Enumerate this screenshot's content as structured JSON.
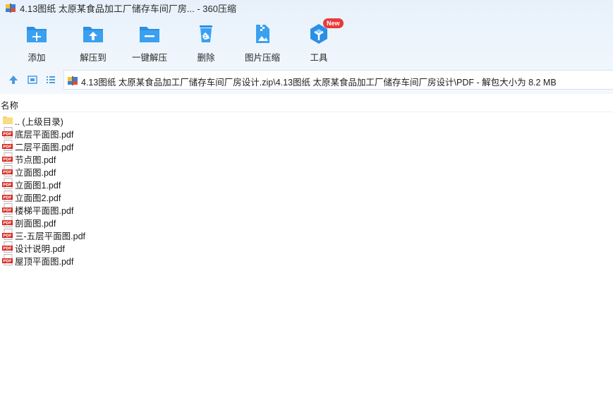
{
  "window": {
    "title": "4.13图纸 太原某食品加工厂储存车间厂房... - 360压缩"
  },
  "toolbar": {
    "items": [
      {
        "label": "添加",
        "icon": "add-folder-icon"
      },
      {
        "label": "解压到",
        "icon": "extract-to-icon"
      },
      {
        "label": "一键解压",
        "icon": "one-click-extract-icon"
      },
      {
        "label": "删除",
        "icon": "recycle-delete-icon"
      },
      {
        "label": "图片压缩",
        "icon": "image-compress-icon"
      },
      {
        "label": "工具",
        "icon": "tools-icon",
        "badge": "New"
      }
    ]
  },
  "address": {
    "path": "4.13图纸 太原某食品加工厂储存车间厂房设计.zip\\4.13图纸 太原某食品加工厂储存车间厂房设计\\PDF - 解包大小为 8.2 MB"
  },
  "columns": {
    "name": "名称"
  },
  "files": [
    {
      "name": ".. (上级目录)",
      "type": "folder"
    },
    {
      "name": "底层平面图.pdf",
      "type": "pdf"
    },
    {
      "name": "二层平面图.pdf",
      "type": "pdf"
    },
    {
      "name": "节点图.pdf",
      "type": "pdf"
    },
    {
      "name": "立面图.pdf",
      "type": "pdf"
    },
    {
      "name": "立面图1.pdf",
      "type": "pdf"
    },
    {
      "name": "立面图2.pdf",
      "type": "pdf"
    },
    {
      "name": "楼梯平面图.pdf",
      "type": "pdf"
    },
    {
      "name": "剖面图.pdf",
      "type": "pdf"
    },
    {
      "name": "三-五层平面图.pdf",
      "type": "pdf"
    },
    {
      "name": "设计说明.pdf",
      "type": "pdf"
    },
    {
      "name": "屋顶平面图.pdf",
      "type": "pdf"
    }
  ],
  "colors": {
    "accent": "#2b8fe6",
    "pdf_red": "#d9251d",
    "folder_yellow": "#f5d16b"
  }
}
